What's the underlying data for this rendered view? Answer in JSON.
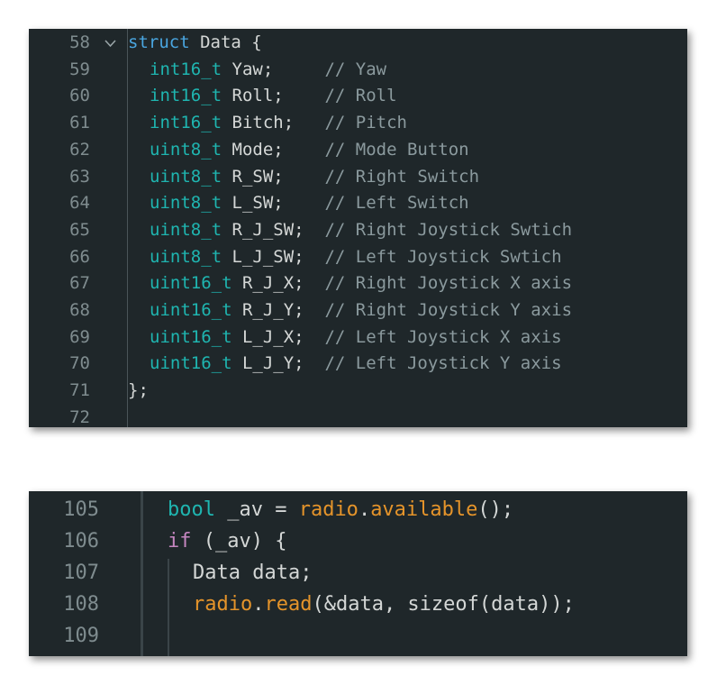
{
  "struct_panel": {
    "lines": [
      {
        "num": "58",
        "kw": "struct",
        "rest": " Data {"
      },
      {
        "num": "59",
        "type": "int16_t",
        "name": " Yaw;     ",
        "comment": "// Yaw"
      },
      {
        "num": "60",
        "type": "int16_t",
        "name": " Roll;    ",
        "comment": "// Roll"
      },
      {
        "num": "61",
        "type": "int16_t",
        "name": " Bitch;   ",
        "comment": "// Pitch"
      },
      {
        "num": "62",
        "type": "uint8_t",
        "name": " Mode;    ",
        "comment": "// Mode Button"
      },
      {
        "num": "63",
        "type": "uint8_t",
        "name": " R_SW;    ",
        "comment": "// Right Switch"
      },
      {
        "num": "64",
        "type": "uint8_t",
        "name": " L_SW;    ",
        "comment": "// Left Switch"
      },
      {
        "num": "65",
        "type": "uint8_t",
        "name": " R_J_SW;  ",
        "comment": "// Right Joystick Swtich"
      },
      {
        "num": "66",
        "type": "uint8_t",
        "name": " L_J_SW;  ",
        "comment": "// Left Joystick Swtich"
      },
      {
        "num": "67",
        "type": "uint16_t",
        "name": " R_J_X;  ",
        "comment": "// Right Joystick X axis"
      },
      {
        "num": "68",
        "type": "uint16_t",
        "name": " R_J_Y;  ",
        "comment": "// Right Joystick Y axis"
      },
      {
        "num": "69",
        "type": "uint16_t",
        "name": " L_J_X;  ",
        "comment": "// Left Joystick X axis"
      },
      {
        "num": "70",
        "type": "uint16_t",
        "name": " L_J_Y;  ",
        "comment": "// Left Joystick Y axis"
      },
      {
        "num": "71",
        "rest": "};"
      },
      {
        "num": "72",
        "rest": ""
      }
    ],
    "fold_icon": "chevron-down-icon"
  },
  "read_panel": {
    "lines": [
      {
        "num": "105",
        "parts": [
          {
            "t": "bool",
            "c": "kw-bool"
          },
          {
            "t": " _av = ",
            "c": "plain"
          },
          {
            "t": "radio",
            "c": "fn"
          },
          {
            "t": ".",
            "c": "plain"
          },
          {
            "t": "available",
            "c": "fn"
          },
          {
            "t": "();",
            "c": "plain"
          }
        ]
      },
      {
        "num": "106",
        "parts": [
          {
            "t": "if",
            "c": "kw-if"
          },
          {
            "t": " (_av) {",
            "c": "plain"
          }
        ]
      },
      {
        "num": "107",
        "parts": [
          {
            "t": "Data data;",
            "c": "plain"
          }
        ]
      },
      {
        "num": "108",
        "parts": [
          {
            "t": "radio",
            "c": "fn"
          },
          {
            "t": ".",
            "c": "plain"
          },
          {
            "t": "read",
            "c": "fn"
          },
          {
            "t": "(&data, sizeof(data));",
            "c": "plain"
          }
        ]
      },
      {
        "num": "109",
        "parts": []
      }
    ]
  }
}
